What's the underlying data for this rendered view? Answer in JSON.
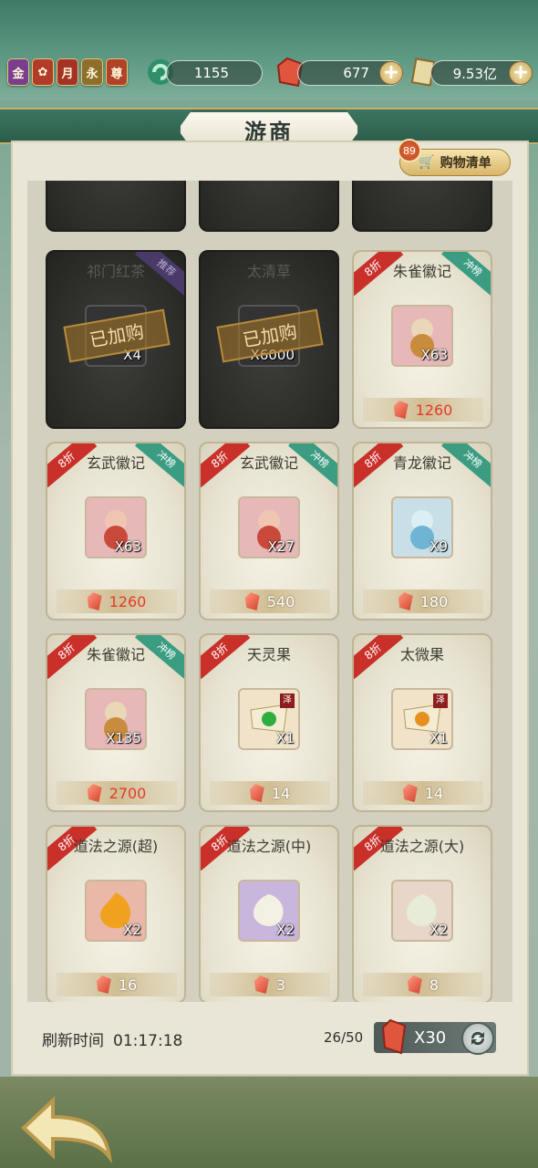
{
  "header": {
    "badges": [
      {
        "label": "金",
        "color": "#7b3d8e"
      },
      {
        "label": "",
        "color": "#b13c29"
      },
      {
        "label": "月",
        "color": "#a43226"
      },
      {
        "label": "永",
        "color": "#8d6e2b"
      },
      {
        "label": "尊",
        "color": "#b0422a"
      }
    ],
    "resources": [
      {
        "icon": "jade-swirl-icon",
        "value": "1155"
      },
      {
        "icon": "red-gem-icon",
        "value": "677"
      },
      {
        "icon": "scroll-icon",
        "value": "9.53亿"
      }
    ]
  },
  "title": "游商",
  "cart": {
    "label": "购物清单",
    "count": "89"
  },
  "tags": {
    "discount": "8折",
    "rank": "冲榜",
    "recommend": "推荐",
    "purchased": "已加购",
    "ze": "泽"
  },
  "items": [
    {
      "name": "祁门红茶",
      "qty": "X4",
      "price": "",
      "purchased": true,
      "tag": "recommend",
      "discount": false
    },
    {
      "name": "太清草",
      "qty": "X6000",
      "price": "",
      "purchased": true,
      "tag": "",
      "discount": false
    },
    {
      "name": "朱雀徽记",
      "qty": "X63",
      "price": "1260",
      "price_red": true,
      "tag": "rank",
      "discount": true
    },
    {
      "name": "玄武徽记",
      "qty": "X63",
      "price": "1260",
      "price_red": true,
      "tag": "rank",
      "discount": true
    },
    {
      "name": "玄武徽记",
      "qty": "X27",
      "price": "540",
      "price_red": false,
      "tag": "rank",
      "discount": true
    },
    {
      "name": "青龙徽记",
      "qty": "X9",
      "price": "180",
      "price_red": false,
      "tag": "rank",
      "discount": true
    },
    {
      "name": "朱雀徽记",
      "qty": "X135",
      "price": "2700",
      "price_red": true,
      "tag": "rank",
      "discount": true
    },
    {
      "name": "天灵果",
      "qty": "X1",
      "price": "14",
      "price_red": false,
      "tag": "",
      "discount": true,
      "ze": true
    },
    {
      "name": "太微果",
      "qty": "X1",
      "price": "14",
      "price_red": false,
      "tag": "",
      "discount": true,
      "ze": true
    },
    {
      "name": "道法之源(超)",
      "qty": "X2",
      "price": "16",
      "price_red": false,
      "tag": "",
      "discount": true
    },
    {
      "name": "道法之源(中)",
      "qty": "X2",
      "price": "3",
      "price_red": false,
      "tag": "",
      "discount": true
    },
    {
      "name": "道法之源(大)",
      "qty": "X2",
      "price": "8",
      "price_red": false,
      "tag": "",
      "discount": true
    }
  ],
  "footer": {
    "refresh_label": "刷新时间",
    "refresh_time": "01:17:18",
    "buy_count": "26/50",
    "refresh_cost": "X30"
  }
}
